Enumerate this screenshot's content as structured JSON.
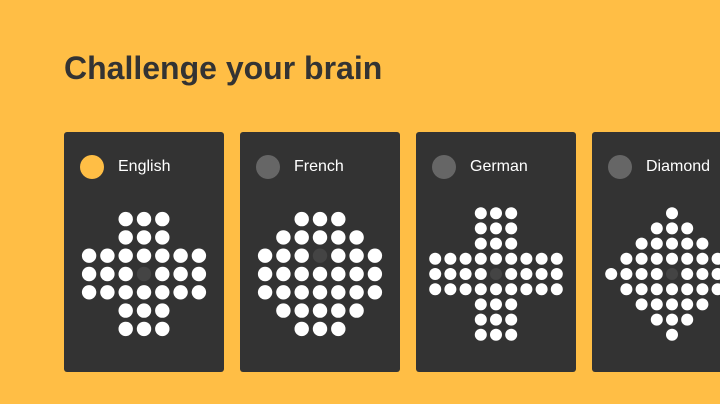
{
  "page": {
    "title": "Challenge your brain"
  },
  "colors": {
    "background": "#FFBE45",
    "card": "#333333",
    "peg": "#FFFFFF",
    "hole": "#444444",
    "radio_selected": "#FFBE45",
    "radio_unselected": "#666666"
  },
  "boards": [
    {
      "label": "English",
      "selected": true,
      "board_icon": "peg-solitaire-english-board",
      "pattern": [
        "..XXX..",
        "..XXX..",
        "XXXXXXX",
        "XXXOXXX",
        "XXXXXXX",
        "..XXX..",
        "..XXX.."
      ]
    },
    {
      "label": "French",
      "selected": false,
      "board_icon": "peg-solitaire-french-board",
      "pattern": [
        "..XXX..",
        ".XXXXX.",
        "XXXOXXX",
        "XXXXXXX",
        "XXXXXXX",
        ".XXXXX.",
        "..XXX.."
      ]
    },
    {
      "label": "German",
      "selected": false,
      "board_icon": "peg-solitaire-german-board",
      "pattern": [
        "...XXX...",
        "...XXX...",
        "...XXX...",
        "XXXXXXXXX",
        "XXXXOXXXX",
        "XXXXXXXXX",
        "...XXX...",
        "...XXX...",
        "...XXX..."
      ]
    },
    {
      "label": "Diamond",
      "selected": false,
      "board_icon": "peg-solitaire-diamond-board",
      "pattern": [
        "....X....",
        "...XXX...",
        "..XXXXX..",
        ".XXXXXXX.",
        "XXXXOXXXX",
        ".XXXXXXX.",
        "..XXXXX..",
        "...XXX...",
        "....X...."
      ]
    }
  ]
}
